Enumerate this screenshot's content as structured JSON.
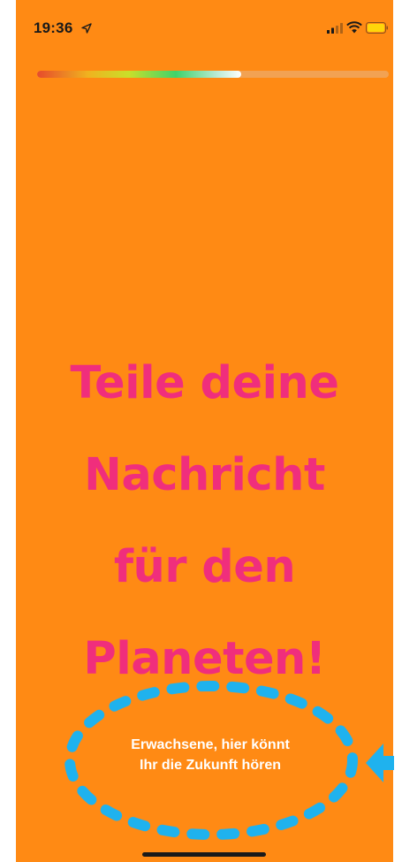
{
  "status_bar": {
    "time": "19:36"
  },
  "progress": {
    "value_percent": 58
  },
  "headline": {
    "lines": [
      "Teile deine",
      "Nachricht",
      "für den",
      "Planeten!"
    ]
  },
  "cta": {
    "line1": "Erwachsene, hier könnt",
    "line2": "Ihr die Zukunft hören"
  },
  "colors": {
    "background": "#ff8a14",
    "headline": "#f02e7c",
    "annotation": "#1fb2ee",
    "cta_text": "#ffffff"
  },
  "icons": [
    "location-arrow-icon",
    "cellular-signal-icon",
    "wifi-icon",
    "battery-icon",
    "pointer-arrow-icon"
  ]
}
